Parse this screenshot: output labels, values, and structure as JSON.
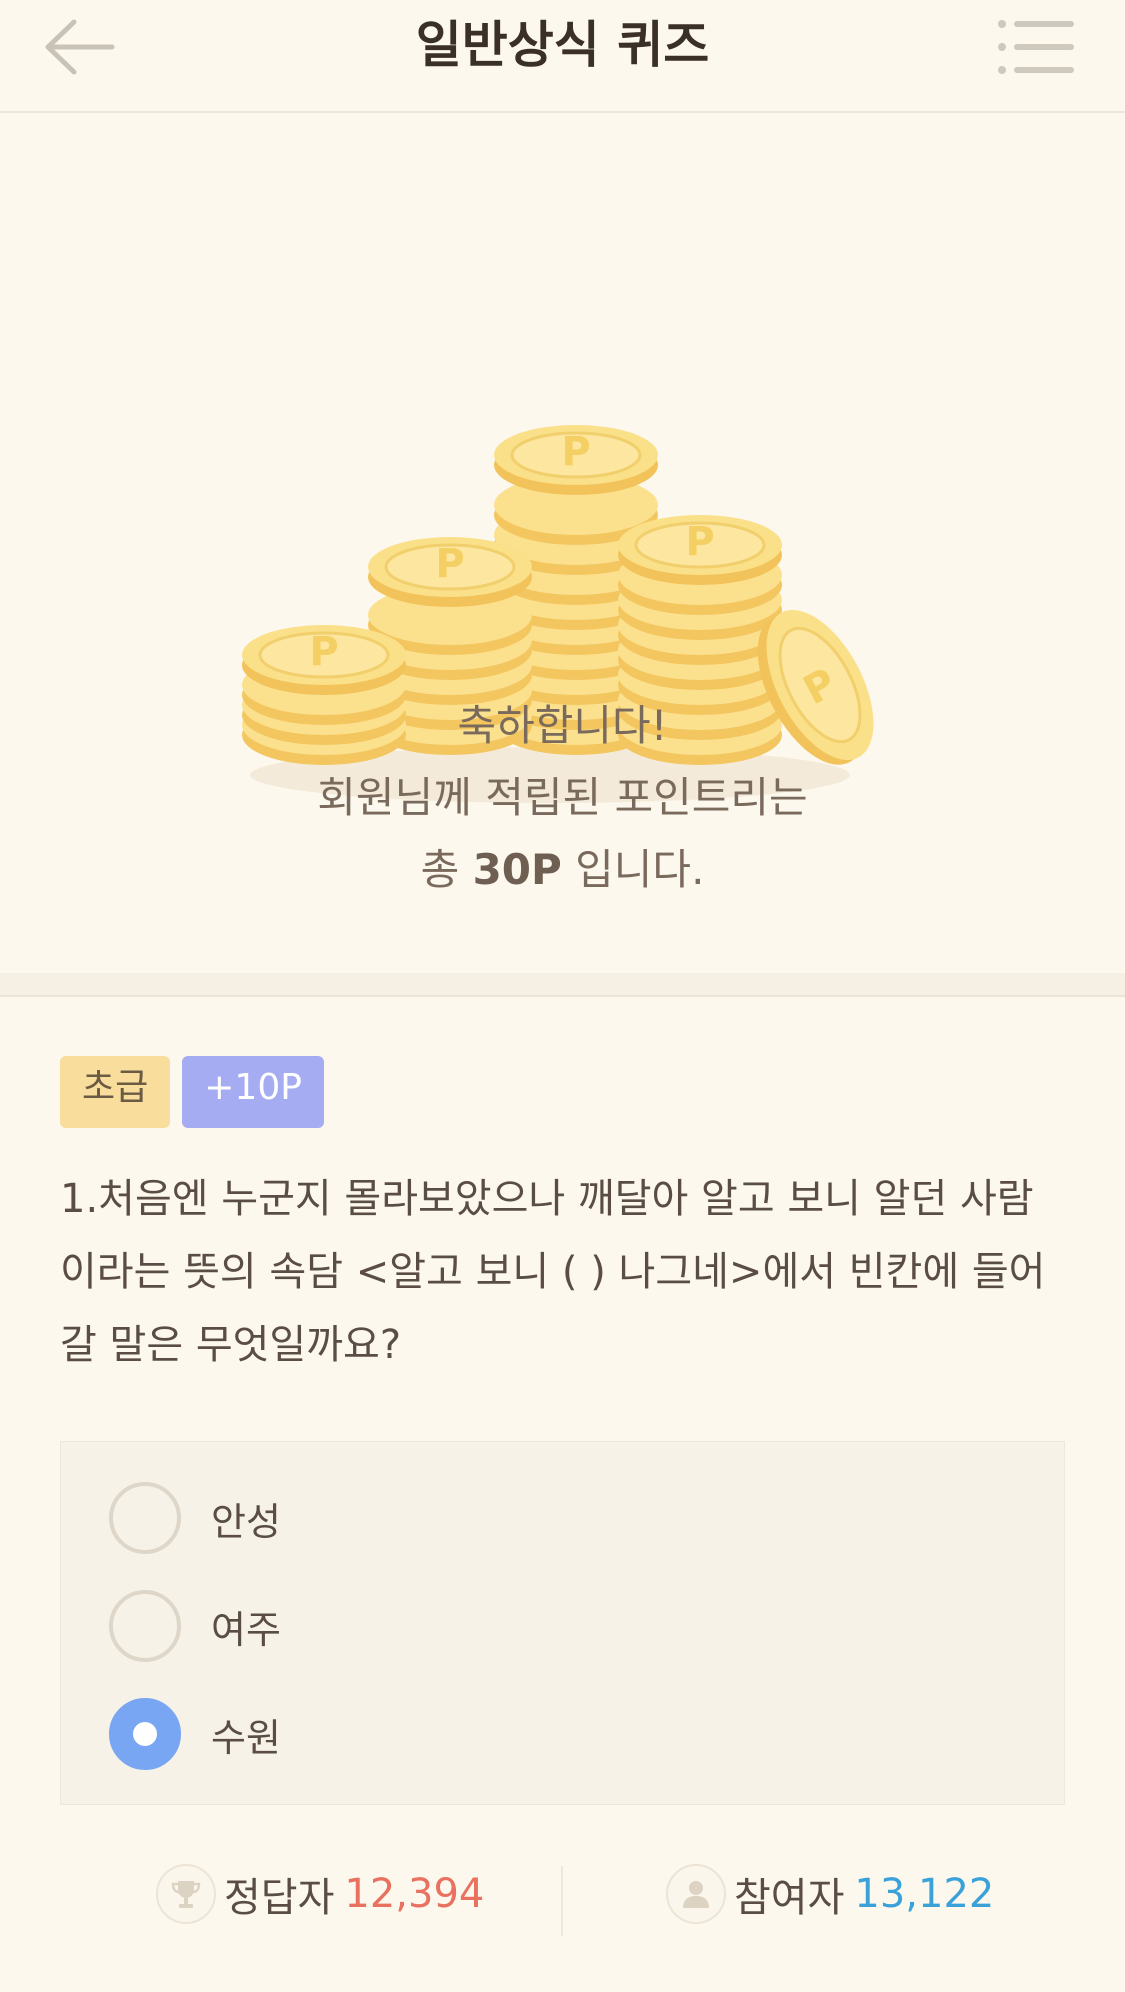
{
  "header": {
    "title": "일반상식 퀴즈",
    "back_icon": "arrow-left-icon",
    "menu_icon": "list-menu-icon"
  },
  "result": {
    "line1": "축하합니다!",
    "line2": "회원님께 적립된 포인트리는",
    "line3_prefix": "총 ",
    "points": "30P",
    "line3_suffix": " 입니다.",
    "coin_label": "P"
  },
  "quiz": {
    "level_badge": "초급",
    "points_badge": "+10P",
    "question": "1.처음엔 누군지 몰라보았으나 깨달아 알고 보니 알던 사람이라는 뜻의 속담 <알고 보니 (  ) 나그네>에서 빈칸에 들어갈 말은 무엇일까요?",
    "options": [
      {
        "label": "안성",
        "selected": false
      },
      {
        "label": "여주",
        "selected": false
      },
      {
        "label": "수원",
        "selected": true
      }
    ]
  },
  "stats": {
    "correct_label": "정답자",
    "correct_value": "12,394",
    "participants_label": "참여자",
    "participants_value": "13,122",
    "correct_icon": "trophy-icon",
    "participants_icon": "person-icon"
  },
  "colors": {
    "background": "#fdf8ee",
    "selected": "#78a6f3",
    "correct_value": "#e8725f",
    "participants_value": "#3aa2d9",
    "level_badge": "#f9dd9c",
    "points_badge": "#a6acf2"
  }
}
